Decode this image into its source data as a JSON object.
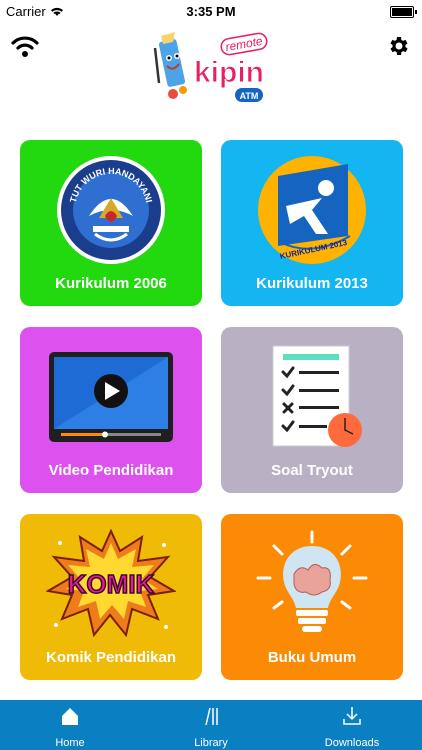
{
  "status_bar": {
    "carrier": "Carrier",
    "time": "3:35 PM"
  },
  "header": {
    "logo_text": "kipin",
    "logo_tag": "remote",
    "logo_badge": "ATM"
  },
  "tiles": [
    {
      "label": "Kurikulum 2006",
      "color": "#22d80e",
      "icon": "tut-wuri-handayani-emblem-icon"
    },
    {
      "label": "Kurikulum 2013",
      "color": "#13b6f0",
      "icon": "kurikulum-2013-logo-icon"
    },
    {
      "label": "Video Pendidikan",
      "color": "#dd52ee",
      "icon": "video-player-icon"
    },
    {
      "label": "Soal Tryout",
      "color": "#b9b1c3",
      "icon": "checklist-clock-icon"
    },
    {
      "label": "Komik Pendidikan",
      "color": "#f0bb06",
      "icon": "komik-burst-icon"
    },
    {
      "label": "Buku Umum",
      "color": "#fb8a05",
      "icon": "lightbulb-brain-icon"
    }
  ],
  "emblems": {
    "k2006": "TUT WURI HANDAYANI",
    "k2013": "KURIKULUM 2013",
    "komik": "KOMIK"
  },
  "tab_bar": {
    "background": "#0a7fc2",
    "tabs": [
      {
        "label": "Home",
        "icon": "home-icon",
        "selected": true
      },
      {
        "label": "Library",
        "icon": "library-icon",
        "selected": false
      },
      {
        "label": "Downloads",
        "icon": "download-icon",
        "selected": false
      }
    ]
  }
}
